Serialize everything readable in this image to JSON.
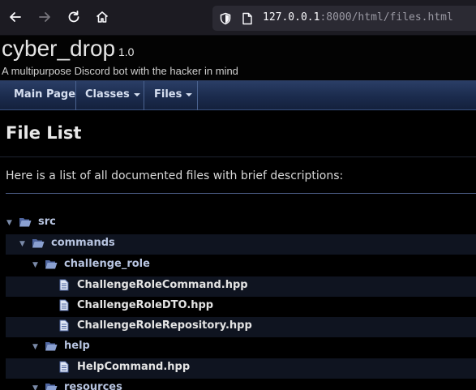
{
  "browser": {
    "url_host": "127.0.0.1",
    "url_rest": ":8000/html/files.html"
  },
  "header": {
    "project_name": "cyber_drop",
    "project_number": "1.0",
    "project_brief": "A multipurpose Discord bot with the hacker in mind"
  },
  "nav": {
    "tabs": [
      {
        "label": "Main Page",
        "has_caret": false
      },
      {
        "label": "Classes",
        "has_caret": true
      },
      {
        "label": "Files",
        "has_caret": true
      }
    ]
  },
  "page": {
    "title": "File List",
    "intro": "Here is a list of all documented files with brief descriptions:"
  },
  "tree": [
    {
      "label": "src",
      "type": "folder",
      "level": 0,
      "expanded": true
    },
    {
      "label": "commands",
      "type": "folder",
      "level": 1,
      "expanded": true
    },
    {
      "label": "challenge_role",
      "type": "folder",
      "level": 2,
      "expanded": true
    },
    {
      "label": "ChallengeRoleCommand.hpp",
      "type": "file",
      "level": 3
    },
    {
      "label": "ChallengeRoleDTO.hpp",
      "type": "file",
      "level": 3
    },
    {
      "label": "ChallengeRoleRepository.hpp",
      "type": "file",
      "level": 3
    },
    {
      "label": "help",
      "type": "folder",
      "level": 2,
      "expanded": true
    },
    {
      "label": "HelpCommand.hpp",
      "type": "file",
      "level": 3
    },
    {
      "label": "resources",
      "type": "folder",
      "level": 2,
      "expanded": true
    }
  ],
  "colors": {
    "background": "#000000",
    "nav_gradient_top": "#2a3e66",
    "folder_icon": "#6f87bf",
    "link_dir": "#b7c4e0"
  }
}
